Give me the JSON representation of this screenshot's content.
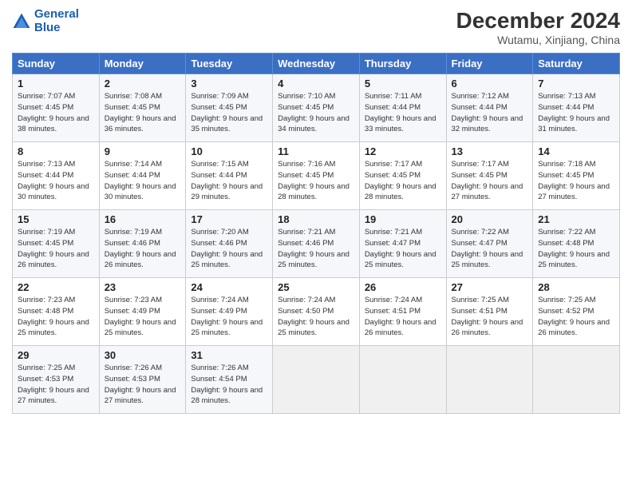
{
  "header": {
    "logo_line1": "General",
    "logo_line2": "Blue",
    "month_year": "December 2024",
    "location": "Wutamu, Xinjiang, China"
  },
  "weekdays": [
    "Sunday",
    "Monday",
    "Tuesday",
    "Wednesday",
    "Thursday",
    "Friday",
    "Saturday"
  ],
  "weeks": [
    [
      {
        "day": "1",
        "sunrise": "Sunrise: 7:07 AM",
        "sunset": "Sunset: 4:45 PM",
        "daylight": "Daylight: 9 hours and 38 minutes."
      },
      {
        "day": "2",
        "sunrise": "Sunrise: 7:08 AM",
        "sunset": "Sunset: 4:45 PM",
        "daylight": "Daylight: 9 hours and 36 minutes."
      },
      {
        "day": "3",
        "sunrise": "Sunrise: 7:09 AM",
        "sunset": "Sunset: 4:45 PM",
        "daylight": "Daylight: 9 hours and 35 minutes."
      },
      {
        "day": "4",
        "sunrise": "Sunrise: 7:10 AM",
        "sunset": "Sunset: 4:45 PM",
        "daylight": "Daylight: 9 hours and 34 minutes."
      },
      {
        "day": "5",
        "sunrise": "Sunrise: 7:11 AM",
        "sunset": "Sunset: 4:44 PM",
        "daylight": "Daylight: 9 hours and 33 minutes."
      },
      {
        "day": "6",
        "sunrise": "Sunrise: 7:12 AM",
        "sunset": "Sunset: 4:44 PM",
        "daylight": "Daylight: 9 hours and 32 minutes."
      },
      {
        "day": "7",
        "sunrise": "Sunrise: 7:13 AM",
        "sunset": "Sunset: 4:44 PM",
        "daylight": "Daylight: 9 hours and 31 minutes."
      }
    ],
    [
      {
        "day": "8",
        "sunrise": "Sunrise: 7:13 AM",
        "sunset": "Sunset: 4:44 PM",
        "daylight": "Daylight: 9 hours and 30 minutes."
      },
      {
        "day": "9",
        "sunrise": "Sunrise: 7:14 AM",
        "sunset": "Sunset: 4:44 PM",
        "daylight": "Daylight: 9 hours and 30 minutes."
      },
      {
        "day": "10",
        "sunrise": "Sunrise: 7:15 AM",
        "sunset": "Sunset: 4:44 PM",
        "daylight": "Daylight: 9 hours and 29 minutes."
      },
      {
        "day": "11",
        "sunrise": "Sunrise: 7:16 AM",
        "sunset": "Sunset: 4:45 PM",
        "daylight": "Daylight: 9 hours and 28 minutes."
      },
      {
        "day": "12",
        "sunrise": "Sunrise: 7:17 AM",
        "sunset": "Sunset: 4:45 PM",
        "daylight": "Daylight: 9 hours and 28 minutes."
      },
      {
        "day": "13",
        "sunrise": "Sunrise: 7:17 AM",
        "sunset": "Sunset: 4:45 PM",
        "daylight": "Daylight: 9 hours and 27 minutes."
      },
      {
        "day": "14",
        "sunrise": "Sunrise: 7:18 AM",
        "sunset": "Sunset: 4:45 PM",
        "daylight": "Daylight: 9 hours and 27 minutes."
      }
    ],
    [
      {
        "day": "15",
        "sunrise": "Sunrise: 7:19 AM",
        "sunset": "Sunset: 4:45 PM",
        "daylight": "Daylight: 9 hours and 26 minutes."
      },
      {
        "day": "16",
        "sunrise": "Sunrise: 7:19 AM",
        "sunset": "Sunset: 4:46 PM",
        "daylight": "Daylight: 9 hours and 26 minutes."
      },
      {
        "day": "17",
        "sunrise": "Sunrise: 7:20 AM",
        "sunset": "Sunset: 4:46 PM",
        "daylight": "Daylight: 9 hours and 25 minutes."
      },
      {
        "day": "18",
        "sunrise": "Sunrise: 7:21 AM",
        "sunset": "Sunset: 4:46 PM",
        "daylight": "Daylight: 9 hours and 25 minutes."
      },
      {
        "day": "19",
        "sunrise": "Sunrise: 7:21 AM",
        "sunset": "Sunset: 4:47 PM",
        "daylight": "Daylight: 9 hours and 25 minutes."
      },
      {
        "day": "20",
        "sunrise": "Sunrise: 7:22 AM",
        "sunset": "Sunset: 4:47 PM",
        "daylight": "Daylight: 9 hours and 25 minutes."
      },
      {
        "day": "21",
        "sunrise": "Sunrise: 7:22 AM",
        "sunset": "Sunset: 4:48 PM",
        "daylight": "Daylight: 9 hours and 25 minutes."
      }
    ],
    [
      {
        "day": "22",
        "sunrise": "Sunrise: 7:23 AM",
        "sunset": "Sunset: 4:48 PM",
        "daylight": "Daylight: 9 hours and 25 minutes."
      },
      {
        "day": "23",
        "sunrise": "Sunrise: 7:23 AM",
        "sunset": "Sunset: 4:49 PM",
        "daylight": "Daylight: 9 hours and 25 minutes."
      },
      {
        "day": "24",
        "sunrise": "Sunrise: 7:24 AM",
        "sunset": "Sunset: 4:49 PM",
        "daylight": "Daylight: 9 hours and 25 minutes."
      },
      {
        "day": "25",
        "sunrise": "Sunrise: 7:24 AM",
        "sunset": "Sunset: 4:50 PM",
        "daylight": "Daylight: 9 hours and 25 minutes."
      },
      {
        "day": "26",
        "sunrise": "Sunrise: 7:24 AM",
        "sunset": "Sunset: 4:51 PM",
        "daylight": "Daylight: 9 hours and 26 minutes."
      },
      {
        "day": "27",
        "sunrise": "Sunrise: 7:25 AM",
        "sunset": "Sunset: 4:51 PM",
        "daylight": "Daylight: 9 hours and 26 minutes."
      },
      {
        "day": "28",
        "sunrise": "Sunrise: 7:25 AM",
        "sunset": "Sunset: 4:52 PM",
        "daylight": "Daylight: 9 hours and 26 minutes."
      }
    ],
    [
      {
        "day": "29",
        "sunrise": "Sunrise: 7:25 AM",
        "sunset": "Sunset: 4:53 PM",
        "daylight": "Daylight: 9 hours and 27 minutes."
      },
      {
        "day": "30",
        "sunrise": "Sunrise: 7:26 AM",
        "sunset": "Sunset: 4:53 PM",
        "daylight": "Daylight: 9 hours and 27 minutes."
      },
      {
        "day": "31",
        "sunrise": "Sunrise: 7:26 AM",
        "sunset": "Sunset: 4:54 PM",
        "daylight": "Daylight: 9 hours and 28 minutes."
      },
      null,
      null,
      null,
      null
    ]
  ]
}
